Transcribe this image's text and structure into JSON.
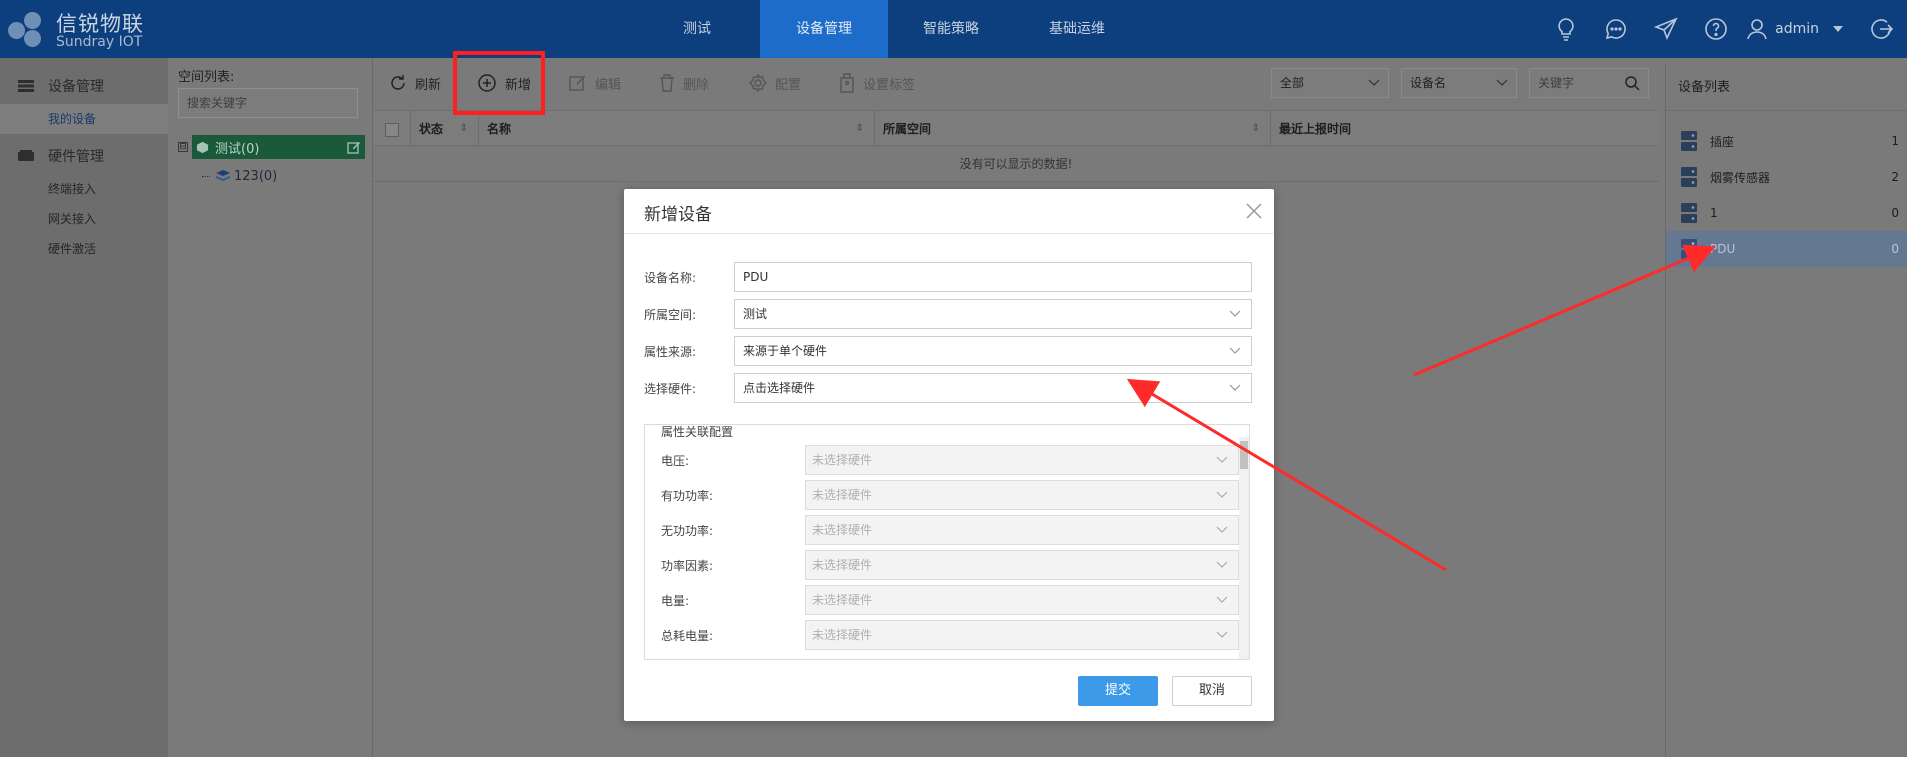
{
  "brand": {
    "name": "信锐物联",
    "sub": "Sundray IOT"
  },
  "topnav": [
    {
      "label": "测试",
      "active": false
    },
    {
      "label": "设备管理",
      "active": true
    },
    {
      "label": "智能策略",
      "active": false
    },
    {
      "label": "基础运维",
      "active": false
    }
  ],
  "user": {
    "name": "admin"
  },
  "leftnav": {
    "device_group": "设备管理",
    "my_devices": "我的设备",
    "hardware_group": "硬件管理",
    "terminal": "终端接入",
    "gateway": "网关接入",
    "activate": "硬件激活"
  },
  "space": {
    "title": "空间列表:",
    "search_placeholder": "搜索关键字",
    "root_label": "测试(0)",
    "root_toggle": "⊟",
    "child_label": "123(0)"
  },
  "toolbar": {
    "refresh": "刷新",
    "add": "新增",
    "edit": "编辑",
    "delete": "删除",
    "config": "配置",
    "tag": "设置标签",
    "filter_all": "全部",
    "filter_field": "设备名",
    "keyword_placeholder": "关键字"
  },
  "grid": {
    "col_status": "状态",
    "col_name": "名称",
    "col_space": "所属空间",
    "col_report": "最近上报时间",
    "empty": "没有可以显示的数据!"
  },
  "device_list": {
    "title": "设备列表",
    "items": [
      {
        "name": "插座",
        "count": "1"
      },
      {
        "name": "烟雾传感器",
        "count": "2"
      },
      {
        "name": "1",
        "count": "0"
      },
      {
        "name": "PDU",
        "count": "0"
      }
    ]
  },
  "modal": {
    "title": "新增设备",
    "name_label": "设备名称:",
    "name_value": "PDU",
    "space_label": "所属空间:",
    "space_value": "测试",
    "source_label": "属性来源:",
    "source_value": "来源于单个硬件",
    "hardware_label": "选择硬件:",
    "hardware_value": "点击选择硬件",
    "section_title": "属性关联配置",
    "props": [
      {
        "label": "电压:",
        "value": "未选择硬件"
      },
      {
        "label": "有功功率:",
        "value": "未选择硬件"
      },
      {
        "label": "无功功率:",
        "value": "未选择硬件"
      },
      {
        "label": "功率因素:",
        "value": "未选择硬件"
      },
      {
        "label": "电量:",
        "value": "未选择硬件"
      },
      {
        "label": "总耗电量:",
        "value": "未选择硬件"
      }
    ],
    "submit": "提交",
    "cancel": "取消"
  },
  "colors": {
    "header": "#0d3f7f",
    "nav_active": "#1e6cc9",
    "primary": "#3d9ae8",
    "annotation": "#ff1f1f"
  }
}
